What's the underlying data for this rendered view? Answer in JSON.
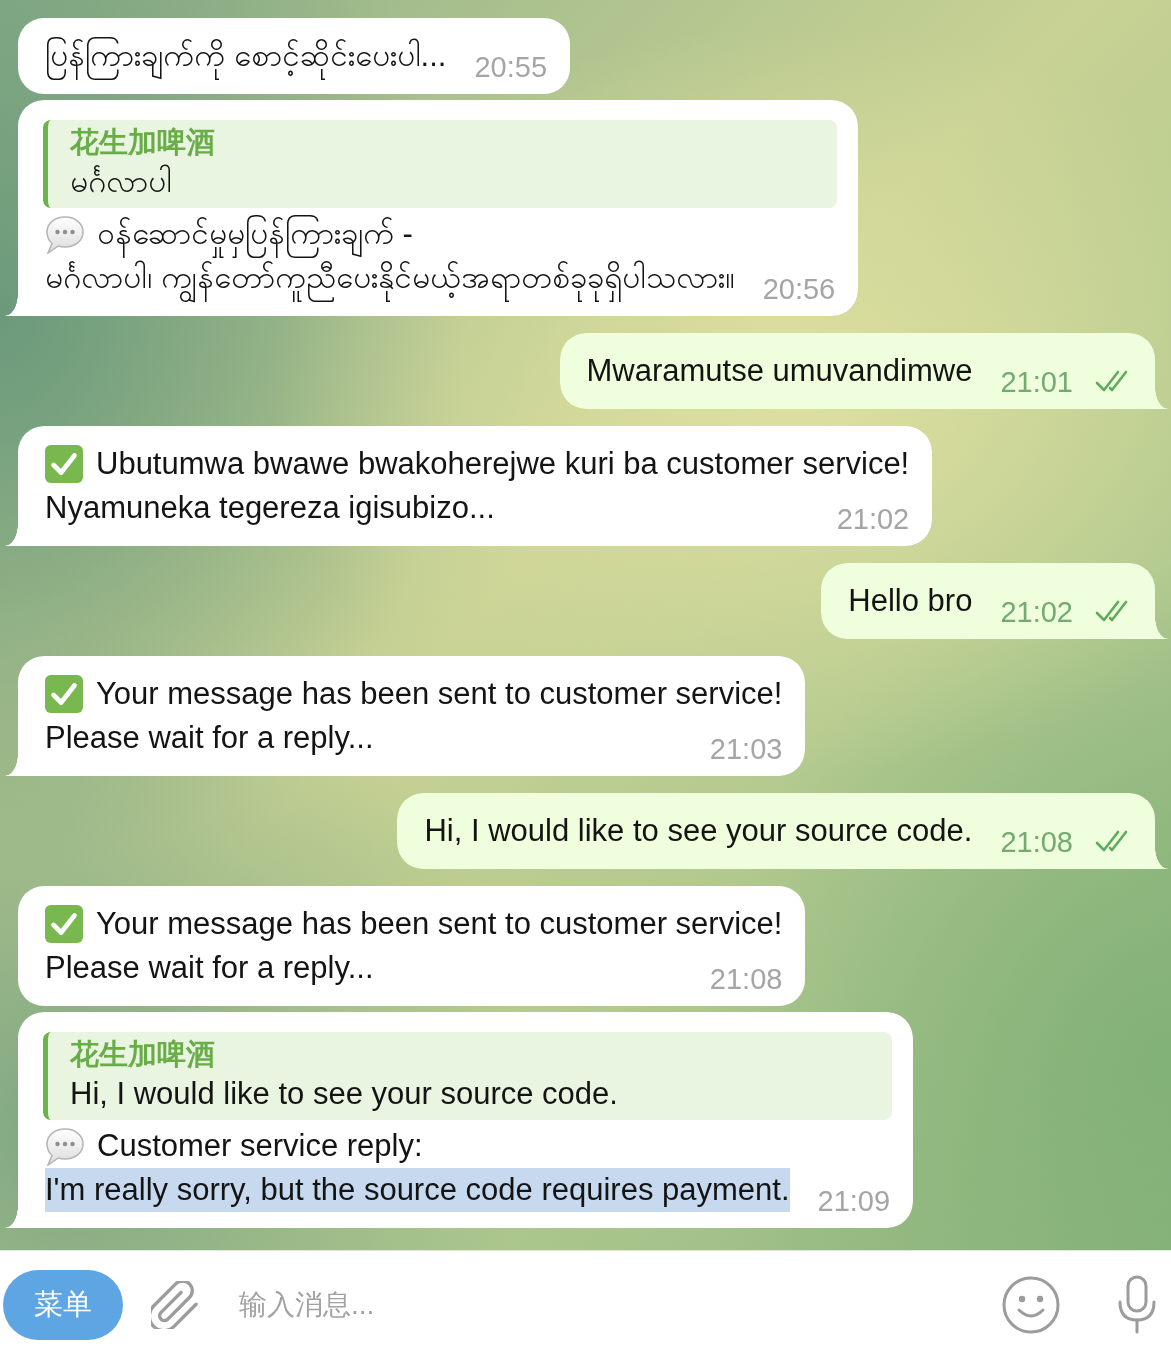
{
  "chat": {
    "messages": [
      {
        "kind": "text",
        "outgoing": false,
        "tail": false,
        "lines": [
          "ပြန်ကြားချက်ကို စောင့်ဆိုင်းပေးပါ..."
        ],
        "time": "20:55"
      },
      {
        "kind": "reply",
        "outgoing": false,
        "tail": true,
        "quote": {
          "author": "花生加啤酒",
          "text": "မင်္ဂလာပါ"
        },
        "label": "ဝန်ဆောင်မှုမှပြန်ကြားချက် -",
        "text": "မင်္ဂလာပါ၊ ကျွန်တော်ကူညီပေးနိုင်မယ့်အရာတစ်ခုခုရှိပါသလား။",
        "text_selected": false,
        "time": "20:56"
      },
      {
        "kind": "text",
        "outgoing": true,
        "tail": true,
        "lines": [
          "Mwaramutse umuvandimwe"
        ],
        "time": "21:01",
        "read": true
      },
      {
        "kind": "notice",
        "outgoing": false,
        "tail": true,
        "lines": [
          "Ubutumwa bwawe bwakoherejwe kuri ba customer service!",
          "Nyamuneka tegereza igisubizo..."
        ],
        "time": "21:02"
      },
      {
        "kind": "text",
        "outgoing": true,
        "tail": true,
        "lines": [
          "Hello bro"
        ],
        "time": "21:02",
        "read": true
      },
      {
        "kind": "notice",
        "outgoing": false,
        "tail": true,
        "lines": [
          "Your message has been sent to customer service!",
          "Please wait for a reply..."
        ],
        "time": "21:03"
      },
      {
        "kind": "text",
        "outgoing": true,
        "tail": true,
        "lines": [
          "Hi, I would like to see your source code."
        ],
        "time": "21:08",
        "read": true
      },
      {
        "kind": "notice",
        "outgoing": false,
        "tail": false,
        "lines": [
          "Your message has been sent to customer service!",
          "Please wait for a reply..."
        ],
        "time": "21:08"
      },
      {
        "kind": "reply",
        "outgoing": false,
        "tail": true,
        "quote": {
          "author": "花生加啤酒",
          "text": "Hi, I would like to see your source code."
        },
        "label": "Customer service reply:",
        "text": "I'm really sorry, but the source code requires payment.",
        "text_selected": true,
        "time": "21:09"
      }
    ]
  },
  "composer": {
    "menu_button": "菜单",
    "placeholder": "输入消息..."
  }
}
